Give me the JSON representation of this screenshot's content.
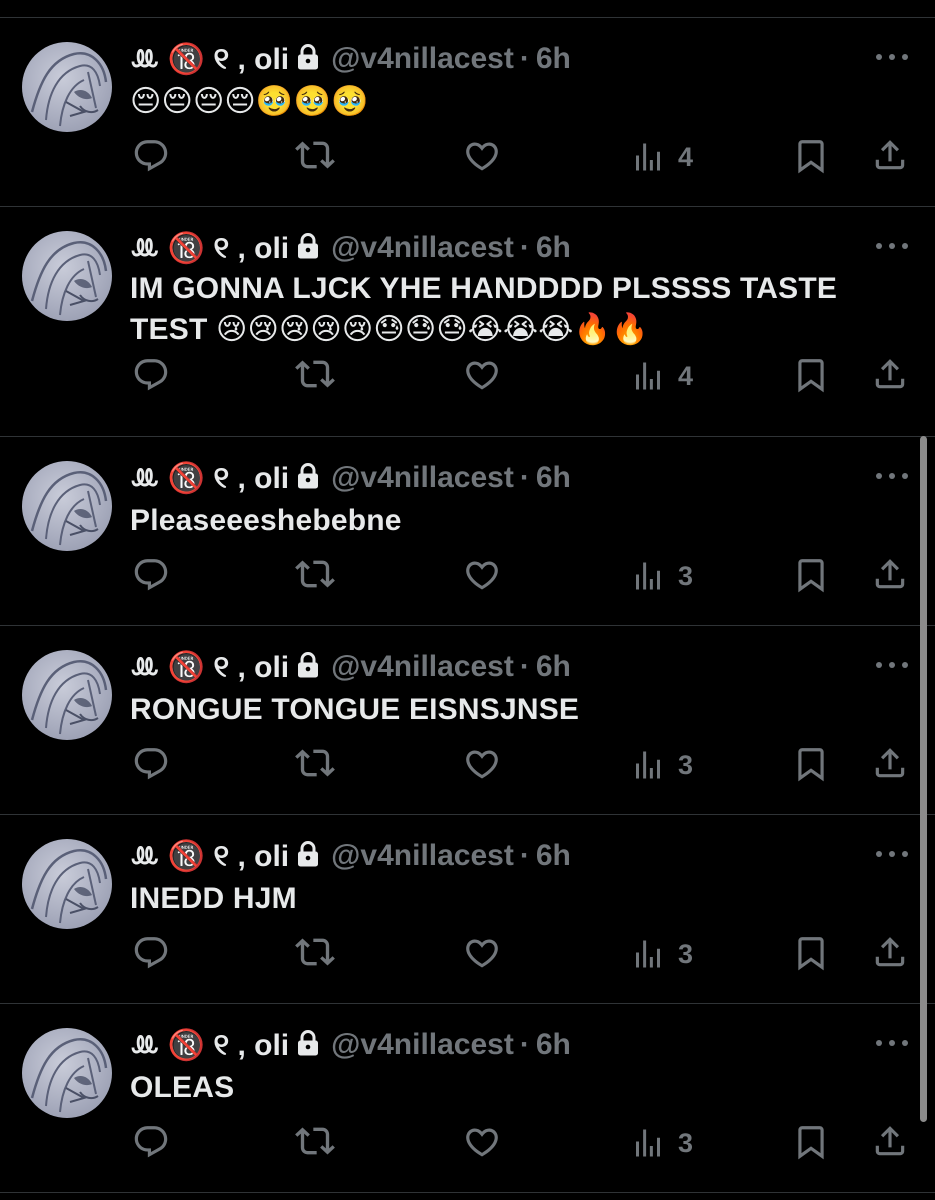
{
  "tweets": [
    {
      "name": "ꔛ 🔞 ୧ , oli",
      "handle": "@v4nillacest",
      "dot": "·",
      "time": "6h",
      "text": "😔😔😔😔🥹🥹🥹",
      "views": "4"
    },
    {
      "name": "ꔛ 🔞 ୧ , oli",
      "handle": "@v4nillacest",
      "dot": "·",
      "time": "6h",
      "text": "IM GONNA LJCK YHE HANDDDD PLSSSS TASTE TEST 😢😢😢😢😢😓😓😓😭😭😭🔥🔥",
      "views": "4"
    },
    {
      "name": "ꔛ 🔞 ୧ , oli",
      "handle": "@v4nillacest",
      "dot": "·",
      "time": "6h",
      "text": "Pleaseeeshebebne",
      "views": "3"
    },
    {
      "name": "ꔛ 🔞 ୧ , oli",
      "handle": "@v4nillacest",
      "dot": "·",
      "time": "6h",
      "text": "RONGUE TONGUE EISNSJNSE",
      "views": "3"
    },
    {
      "name": "ꔛ 🔞 ୧ , oli",
      "handle": "@v4nillacest",
      "dot": "·",
      "time": "6h",
      "text": "INEDD HJM",
      "views": "3"
    },
    {
      "name": "ꔛ 🔞 ୧ , oli",
      "handle": "@v4nillacest",
      "dot": "·",
      "time": "6h",
      "text": "OLEAS",
      "views": "3"
    }
  ],
  "icons": [
    "reply-icon",
    "retweet-icon",
    "like-icon",
    "views-icon",
    "bookmark-icon",
    "share-icon",
    "more-icon",
    "lock-icon"
  ],
  "colors": {
    "background": "#000000",
    "text": "#e7e9ea",
    "muted": "#71767b",
    "divider": "#2f3336"
  }
}
